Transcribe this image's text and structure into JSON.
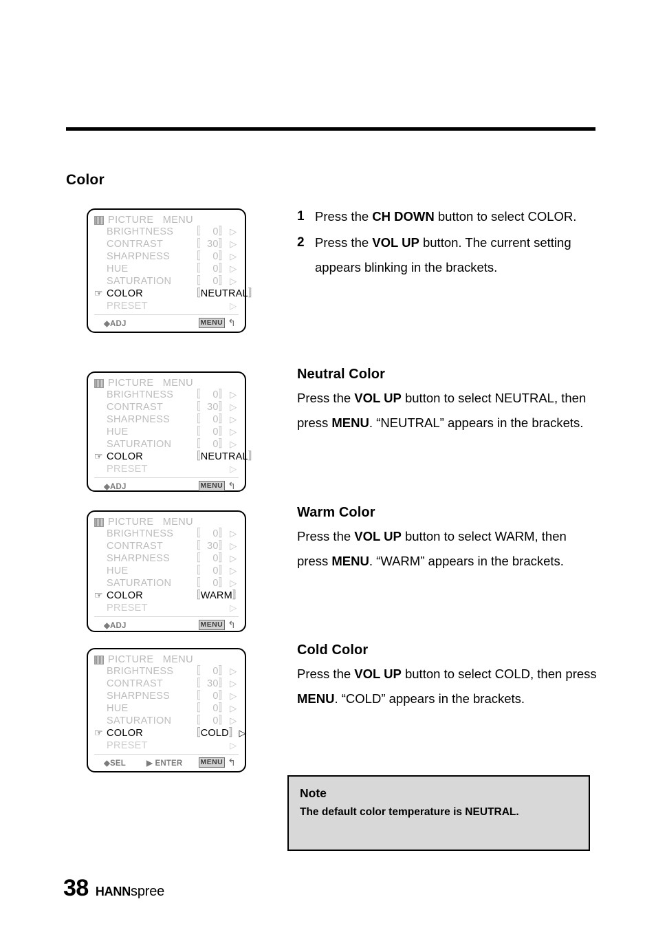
{
  "page": {
    "section_title": "Color",
    "page_number": "38",
    "brand_bold": "HANN",
    "brand_light": "spree"
  },
  "osd_common": {
    "title": "PICTURE   MENU",
    "icon": "picture-menu-icon",
    "pointer": "☞",
    "arrow": "▷",
    "bracket_left": "〚",
    "bracket_right": "〛",
    "rows": [
      {
        "label": "BRIGHTNESS",
        "value": "0"
      },
      {
        "label": "CONTRAST",
        "value": "30"
      },
      {
        "label": "SHARPNESS",
        "value": "0"
      },
      {
        "label": "HUE",
        "value": "0"
      },
      {
        "label": "SATURATION",
        "value": "0"
      }
    ],
    "color_label": "COLOR",
    "preset_label": "PRESET",
    "footer_adj": "ADJ",
    "footer_sel": "SEL",
    "footer_enter": "ENTER",
    "footer_menu": "MENU",
    "footer_return": "↰",
    "diamond": "◆",
    "triangle": "▶"
  },
  "osd_panels": [
    {
      "id": "osd-neutral-1",
      "color_value": "NEUTRAL",
      "footer_mode": "adj"
    },
    {
      "id": "osd-neutral-2",
      "color_value": "NEUTRAL",
      "footer_mode": "adj"
    },
    {
      "id": "osd-warm",
      "color_value": "WARM",
      "footer_mode": "adj"
    },
    {
      "id": "osd-cold",
      "color_value": "COLD",
      "footer_mode": "sel"
    }
  ],
  "steps": [
    {
      "num": "1",
      "parts": [
        {
          "t": "Press the ",
          "b": false
        },
        {
          "t": "CH DOWN",
          "b": true
        },
        {
          "t": " button to select COLOR.",
          "b": false
        }
      ]
    },
    {
      "num": "2",
      "parts": [
        {
          "t": "Press the ",
          "b": false
        },
        {
          "t": "VOL UP",
          "b": true
        },
        {
          "t": " button. The current setting appears blinking in the brackets.",
          "b": false
        }
      ]
    }
  ],
  "blocks": [
    {
      "heading": "Neutral Color",
      "parts": [
        {
          "t": "Press the ",
          "b": false
        },
        {
          "t": "VOL UP",
          "b": true
        },
        {
          "t": " button to select NEUTRAL, then press ",
          "b": false
        },
        {
          "t": "MENU",
          "b": true
        },
        {
          "t": ". “NEUTRAL” appears in the brackets.",
          "b": false
        }
      ]
    },
    {
      "heading": "Warm Color",
      "parts": [
        {
          "t": "Press the ",
          "b": false
        },
        {
          "t": "VOL UP",
          "b": true
        },
        {
          "t": " button to select WARM, then press ",
          "b": false
        },
        {
          "t": "MENU",
          "b": true
        },
        {
          "t": ". “WARM” appears in the brackets.",
          "b": false
        }
      ]
    },
    {
      "heading": "Cold Color",
      "parts": [
        {
          "t": "Press the ",
          "b": false
        },
        {
          "t": "VOL UP",
          "b": true
        },
        {
          "t": " button to select COLD, then press ",
          "b": false
        },
        {
          "t": "MENU",
          "b": true
        },
        {
          "t": ". “COLD” appears in the brackets.",
          "b": false
        }
      ]
    }
  ],
  "note": {
    "title": "Note",
    "body": "The default color temperature is NEUTRAL."
  },
  "colors": {
    "note_background": "#d8d8d8",
    "osd_dim_text": "#bdbdbd",
    "osd_active_text": "#000000",
    "rule": "#000000"
  }
}
